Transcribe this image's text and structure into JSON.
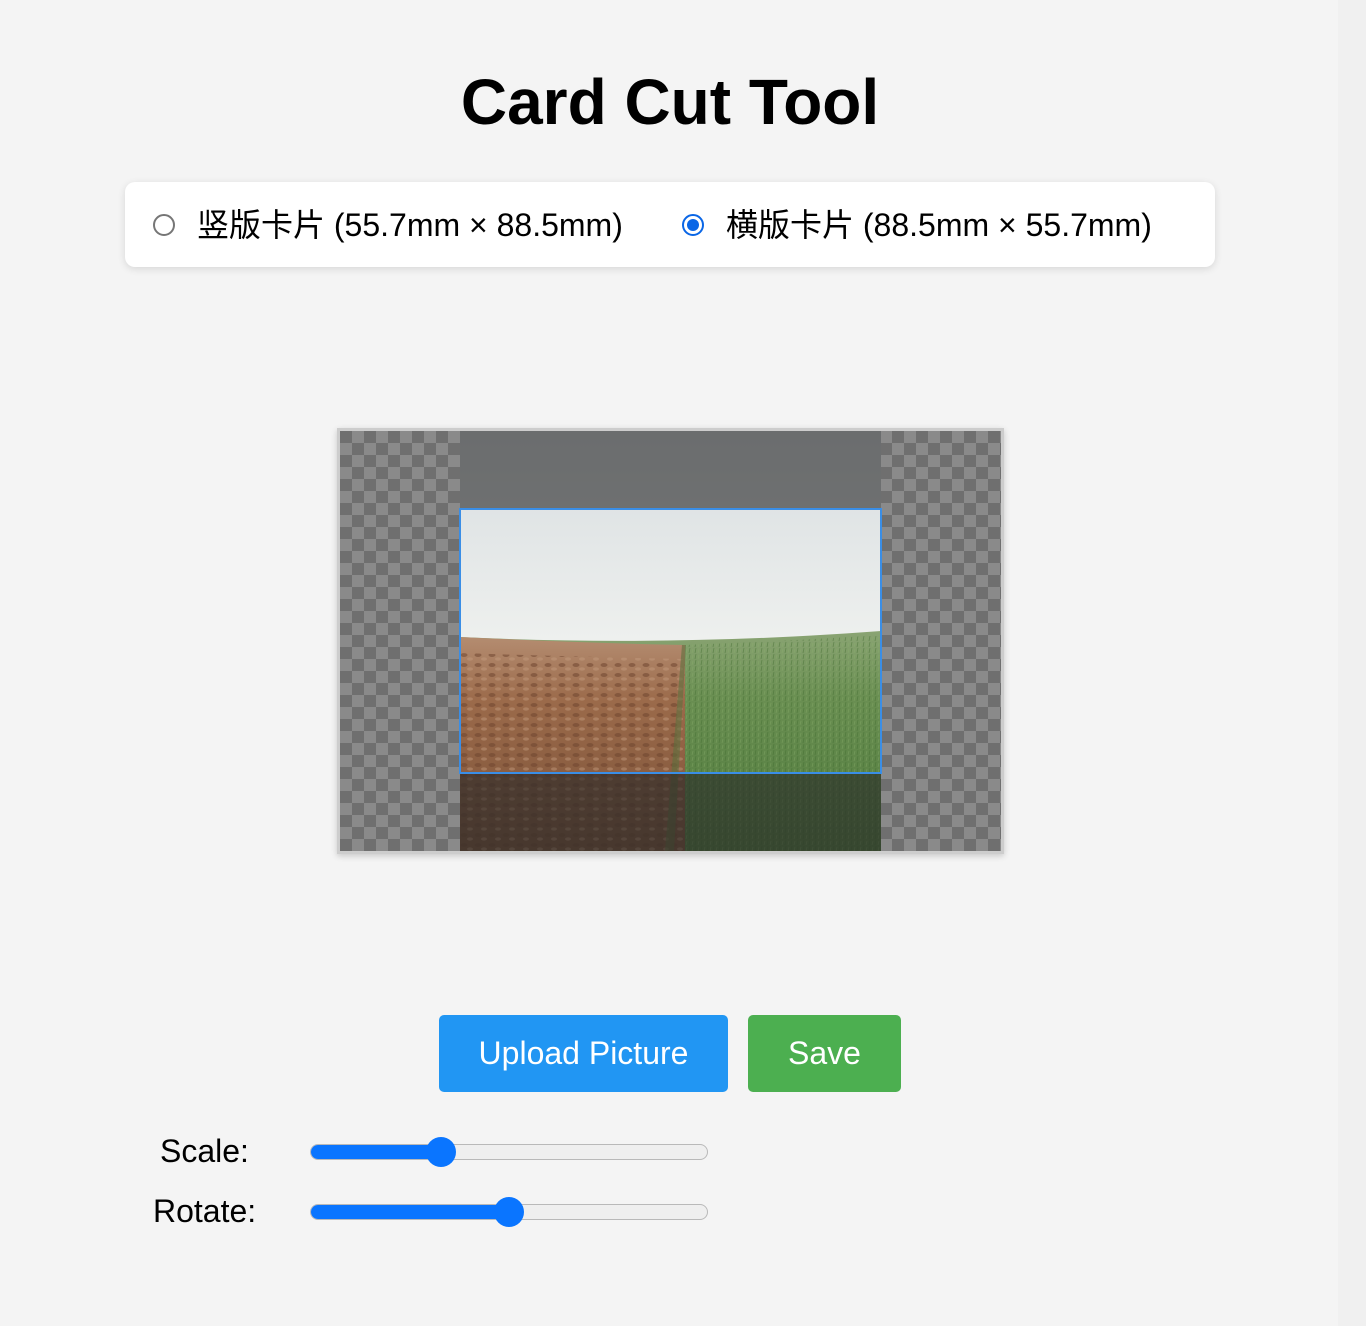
{
  "page": {
    "title": "Card Cut Tool"
  },
  "orientation": {
    "options": [
      {
        "label": "竖版卡片 (55.7mm × 88.5mm)",
        "checked": false
      },
      {
        "label": "横版卡片 (88.5mm × 55.7mm)",
        "checked": true
      }
    ]
  },
  "preview": {
    "image_content": "field-landscape",
    "crop_aspect": "88.5:55.7"
  },
  "actions": {
    "upload_label": "Upload Picture",
    "save_label": "Save",
    "upload_color": "#2196f3",
    "save_color": "#4caf50"
  },
  "controls": {
    "scale": {
      "label": "Scale:",
      "value_fraction": 0.33
    },
    "rotate": {
      "label": "Rotate:",
      "value_fraction": 0.5
    }
  },
  "colors": {
    "accent": "#0a75ff",
    "crop_border": "#3a8ee6",
    "background": "#f4f4f4"
  }
}
